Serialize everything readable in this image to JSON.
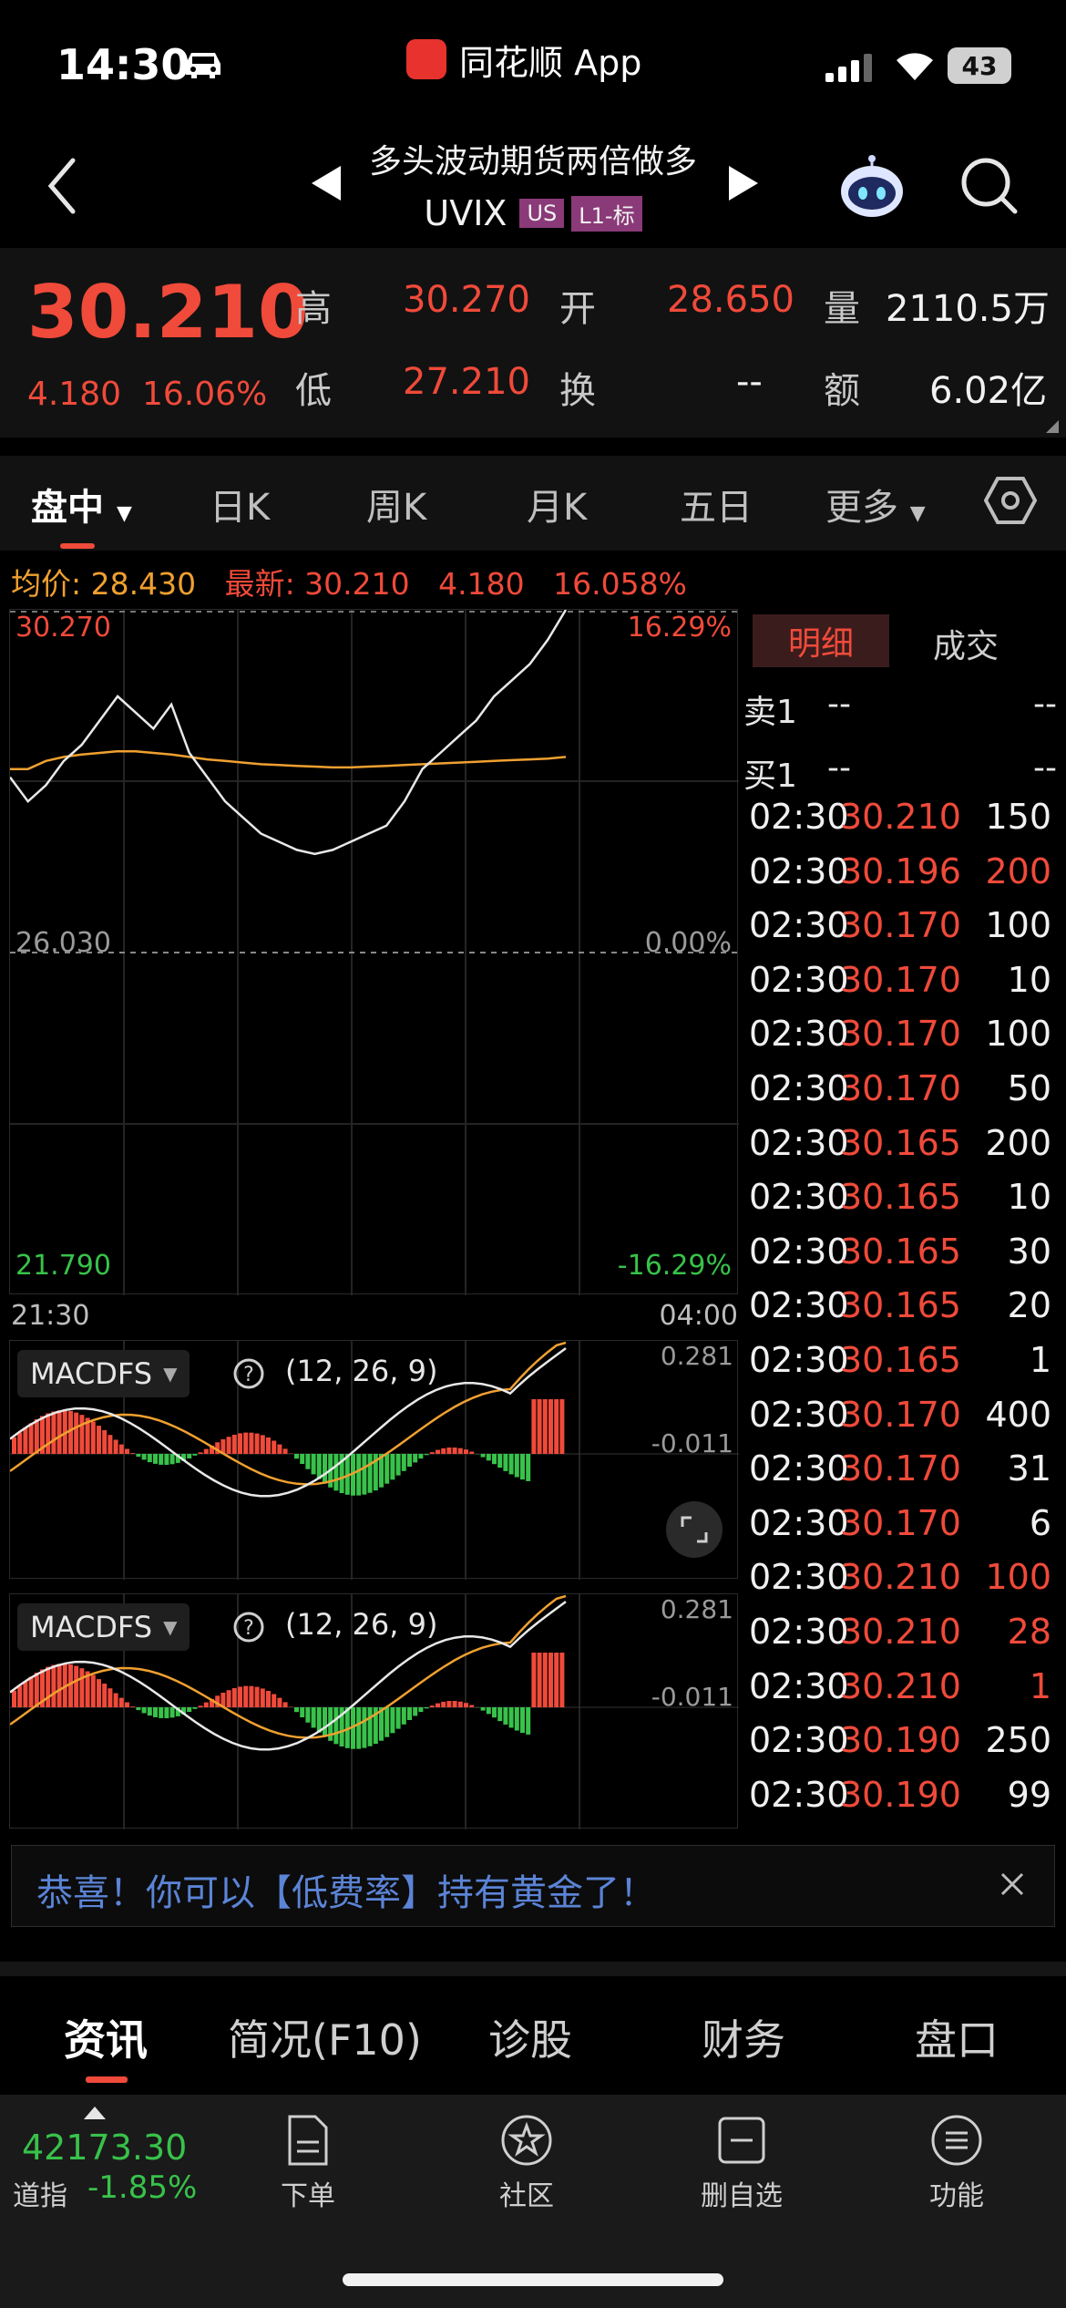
{
  "status_bar": {
    "time": "14:30",
    "app_label": "同花顺 App",
    "battery": "43"
  },
  "header": {
    "name": "多头波动期货两倍做多",
    "code": "UVIX",
    "tag_market": "US",
    "tag_level": "L1-标"
  },
  "quote": {
    "last": "30.210",
    "change": "4.180",
    "change_pct": "16.06%",
    "high_label": "高",
    "high": "30.270",
    "open_label": "开",
    "open": "28.650",
    "volume_label": "量",
    "volume": "2110.5万",
    "low_label": "低",
    "low": "27.210",
    "turnover_label": "换",
    "turnover": "--",
    "amount_label": "额",
    "amount": "6.02亿"
  },
  "period_tabs": [
    "盘中",
    "日K",
    "周K",
    "月K",
    "五日",
    "更多"
  ],
  "info_bar": {
    "avg_label": "均价: ",
    "avg": "28.430",
    "latest_label": "最新: ",
    "latest": "30.210",
    "change": "4.180",
    "change_pct": "16.058%"
  },
  "main_chart": {
    "top_price": "30.270",
    "top_pct": "16.29%",
    "mid_price": "26.030",
    "mid_pct": "0.00%",
    "bottom_price": "21.790",
    "bottom_pct": "-16.29%",
    "time_start": "21:30",
    "time_end": "04:00"
  },
  "chart_data": {
    "type": "line",
    "ylim": [
      21.79,
      30.27
    ],
    "x_start": "21:30",
    "x_end": "04:00",
    "price": [
      28.2,
      27.9,
      28.1,
      28.4,
      28.6,
      28.9,
      29.2,
      29.0,
      28.8,
      29.1,
      28.5,
      28.2,
      27.9,
      27.7,
      27.5,
      27.4,
      27.3,
      27.25,
      27.3,
      27.4,
      27.5,
      27.6,
      27.9,
      28.3,
      28.5,
      28.7,
      28.9,
      29.2,
      29.4,
      29.6,
      29.9,
      30.27
    ],
    "avg": [
      28.3,
      28.3,
      28.4,
      28.45,
      28.48,
      28.5,
      28.52,
      28.52,
      28.5,
      28.48,
      28.45,
      28.42,
      28.4,
      28.38,
      28.36,
      28.35,
      28.34,
      28.33,
      28.32,
      28.32,
      28.33,
      28.34,
      28.35,
      28.36,
      28.37,
      28.38,
      28.39,
      28.4,
      28.41,
      28.42,
      28.43,
      28.45
    ]
  },
  "macd1": {
    "name": "MACDFS",
    "params": "(12, 26, 9)",
    "top": "0.281",
    "mid": "-0.011"
  },
  "macd2": {
    "name": "MACDFS",
    "params": "(12, 26, 9)",
    "top": "0.281",
    "mid": "-0.011"
  },
  "detail_tabs": {
    "active": "明细",
    "other": "成交"
  },
  "order_book": [
    {
      "label": "卖1",
      "price": "--",
      "volume": "--"
    },
    {
      "label": "买1",
      "price": "--",
      "volume": "--"
    }
  ],
  "ticks": [
    {
      "time": "02:30",
      "price": "30.210",
      "volume": "150",
      "side": "white"
    },
    {
      "time": "02:30",
      "price": "30.196",
      "volume": "200",
      "side": "red"
    },
    {
      "time": "02:30",
      "price": "30.170",
      "volume": "100",
      "side": "white"
    },
    {
      "time": "02:30",
      "price": "30.170",
      "volume": "10",
      "side": "white"
    },
    {
      "time": "02:30",
      "price": "30.170",
      "volume": "100",
      "side": "white"
    },
    {
      "time": "02:30",
      "price": "30.170",
      "volume": "50",
      "side": "white"
    },
    {
      "time": "02:30",
      "price": "30.165",
      "volume": "200",
      "side": "white"
    },
    {
      "time": "02:30",
      "price": "30.165",
      "volume": "10",
      "side": "white"
    },
    {
      "time": "02:30",
      "price": "30.165",
      "volume": "30",
      "side": "white"
    },
    {
      "time": "02:30",
      "price": "30.165",
      "volume": "20",
      "side": "white"
    },
    {
      "time": "02:30",
      "price": "30.165",
      "volume": "1",
      "side": "white"
    },
    {
      "time": "02:30",
      "price": "30.170",
      "volume": "400",
      "side": "white"
    },
    {
      "time": "02:30",
      "price": "30.170",
      "volume": "31",
      "side": "white"
    },
    {
      "time": "02:30",
      "price": "30.170",
      "volume": "6",
      "side": "white"
    },
    {
      "time": "02:30",
      "price": "30.210",
      "volume": "100",
      "side": "red"
    },
    {
      "time": "02:30",
      "price": "30.210",
      "volume": "28",
      "side": "red"
    },
    {
      "time": "02:30",
      "price": "30.210",
      "volume": "1",
      "side": "red"
    },
    {
      "time": "02:30",
      "price": "30.190",
      "volume": "250",
      "side": "white"
    },
    {
      "time": "02:30",
      "price": "30.190",
      "volume": "99",
      "side": "white"
    }
  ],
  "promo": {
    "text": "恭喜！你可以【低费率】持有黄金了！"
  },
  "bottom_tabs": [
    "资讯",
    "简况(F10)",
    "诊股",
    "财务",
    "盘口"
  ],
  "footer": {
    "index_value": "42173.30",
    "index_name": "道指",
    "index_change": "-1.85%",
    "buttons": [
      "下单",
      "社区",
      "删自选",
      "功能"
    ]
  },
  "colors": {
    "up": "#f04a3a",
    "down": "#38c24a",
    "avg": "#f0a030",
    "line": "#e8e8e8"
  }
}
